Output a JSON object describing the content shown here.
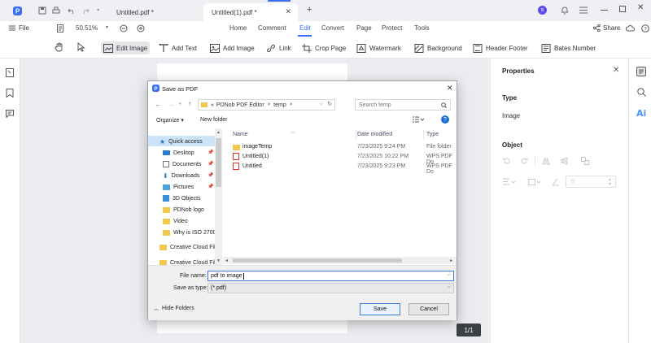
{
  "titlebar": {
    "tabs": [
      {
        "label": "Untitled.pdf *"
      },
      {
        "label": "Untitled(1).pdf *"
      }
    ],
    "new_tab": "+",
    "avatar_letter": "s"
  },
  "menubar": {
    "file_label": "File",
    "zoom": "50.51%",
    "items": [
      "Home",
      "Comment",
      "Edit",
      "Convert",
      "Page",
      "Protect",
      "Tools"
    ],
    "active_item": "Edit",
    "share_label": "Share"
  },
  "toolbar": {
    "edit_image": "Edit Image",
    "add_text": "Add Text",
    "add_image": "Add Image",
    "link": "Link",
    "crop_page": "Crop Page",
    "watermark": "Watermark",
    "background": "Background",
    "header_footer": "Header Footer",
    "bates_number": "Bates Number"
  },
  "properties": {
    "title": "Properties",
    "type_heading": "Type",
    "type_value": "Image",
    "object_heading": "Object",
    "rotation_value": "0"
  },
  "canvas": {
    "page_indicator": "1/1"
  },
  "dialog": {
    "title": "Save as PDF",
    "breadcrumb": [
      "«",
      "PDNob PDF Editor",
      ">",
      "temp",
      ">"
    ],
    "search_placeholder": "Search temp",
    "organize": "Organize ▾",
    "new_folder": "New folder",
    "nav_items": [
      {
        "label": "Quick access",
        "pinned": false
      },
      {
        "label": "Desktop",
        "pinned": true
      },
      {
        "label": "Documents",
        "pinned": true
      },
      {
        "label": "Downloads",
        "pinned": true
      },
      {
        "label": "Pictures",
        "pinned": true
      },
      {
        "label": "3D Objects",
        "pinned": false
      },
      {
        "label": "PDNob logo",
        "pinned": false
      },
      {
        "label": "Video",
        "pinned": false
      },
      {
        "label": "Why is ISO 2700",
        "pinned": false
      },
      {
        "label": "Creative Cloud Fil",
        "pinned": false
      },
      {
        "label": "Creative Cloud Fil",
        "pinned": false
      }
    ],
    "columns": {
      "name": "Name",
      "date": "Date modified",
      "type": "Type"
    },
    "files": [
      {
        "name": "imageTemp",
        "date": "7/23/2025 9:24 PM",
        "type": "File folder",
        "kind": "folder"
      },
      {
        "name": "Untitled(1)",
        "date": "7/23/2025 10:22 PM",
        "type": "WPS PDF Do",
        "kind": "pdf"
      },
      {
        "name": "Untitled",
        "date": "7/23/2025 9:23 PM",
        "type": "WPS PDF Do",
        "kind": "pdf"
      }
    ],
    "file_name_label": "File name:",
    "file_name_value": "pdf to image",
    "save_type_label": "Save as type:",
    "save_type_value": "(*.pdf)",
    "hide_folders": "Hide Folders",
    "save": "Save",
    "cancel": "Cancel"
  },
  "colors": {
    "accent": "#3b6cf6",
    "ai_blue": "#4a90ff"
  }
}
